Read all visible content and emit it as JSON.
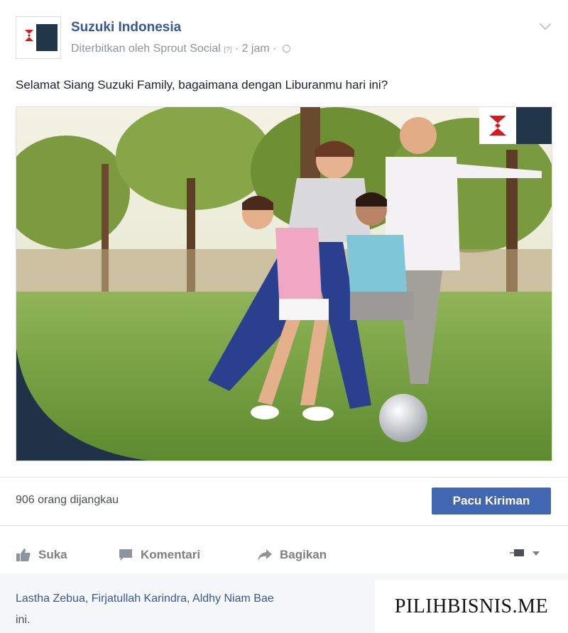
{
  "post": {
    "page_name": "Suzuki Indonesia",
    "published_by": "Diterbitkan oleh Sprout Social",
    "published_tag": "[?]",
    "time": "· 2 jam ·",
    "message": "Selamat Siang Suzuki Family, bagaimana dengan Liburanmu hari ini?"
  },
  "photo": {
    "alt": "Keluarga bermain sepak bola di taman",
    "brand_logo": "Suzuki logo"
  },
  "reach": {
    "text": "906 orang dijangkau",
    "boost_label": "Pacu Kiriman"
  },
  "actions": {
    "like": "Suka",
    "comment": "Komentari",
    "share": "Bagikan"
  },
  "likers": {
    "names": "Lastha Zebua, Firjatullah Karindra, Aldhy Niam Bae",
    "suffix": "ini."
  },
  "watermark": "PILIHBISNIS.ME",
  "colors": {
    "link_blue": "#365899",
    "button_blue": "#4267b2",
    "muted_gray": "#90949c"
  }
}
